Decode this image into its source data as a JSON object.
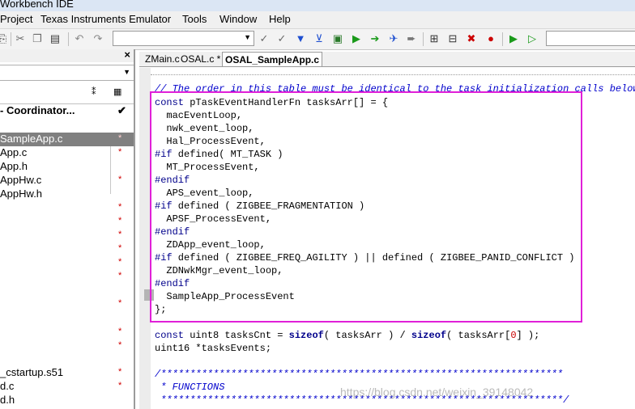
{
  "title": "Workbench IDE",
  "menu": [
    "Project",
    "Texas Instruments Emulator",
    "Tools",
    "Window",
    "Help"
  ],
  "workspace": {
    "config": "- Coordinator...",
    "config_check": "✔",
    "files": [
      {
        "name": "SampleApp.c",
        "mark": "*"
      },
      {
        "name": "App.c",
        "mark": "*"
      },
      {
        "name": "App.h",
        "mark": ""
      },
      {
        "name": "AppHw.c",
        "mark": "*"
      },
      {
        "name": "AppHw.h",
        "mark": ""
      },
      {
        "name": "",
        "mark": "*"
      },
      {
        "name": "",
        "mark": "*"
      },
      {
        "name": "",
        "mark": "*"
      },
      {
        "name": "",
        "mark": "*"
      },
      {
        "name": "",
        "mark": "*"
      },
      {
        "name": "",
        "mark": "*"
      },
      {
        "name": "",
        "mark": "*"
      },
      {
        "name": "",
        "mark": "*"
      },
      {
        "name": "_cstartup.s51",
        "mark": "*"
      },
      {
        "name": "d.c",
        "mark": "*"
      },
      {
        "name": "d.h",
        "mark": ""
      }
    ]
  },
  "tabs": [
    {
      "label": "ZMain.c"
    },
    {
      "label": "OSAL.c *"
    },
    {
      "label": "OSAL_SampleApp.c"
    }
  ],
  "code": {
    "comment_top": "// The order in this table must be identical to the task initialization calls below i",
    "l1_kw": "const",
    "l1_rest": " pTaskEventHandlerFn tasksArr[] = {",
    "l2": "  macEventLoop,",
    "l3": "  nwk_event_loop,",
    "l4": "  Hal_ProcessEvent,",
    "l5_kw": "#if",
    "l5_rest": " defined( MT_TASK )",
    "l6": "  MT_ProcessEvent,",
    "l7_kw": "#endif",
    "l8": "  APS_event_loop,",
    "l9_kw": "#if",
    "l9_rest": " defined ( ZIGBEE_FRAGMENTATION )",
    "l10": "  APSF_ProcessEvent,",
    "l11_kw": "#endif",
    "l12": "  ZDApp_event_loop,",
    "l13_kw": "#if",
    "l13_rest": " defined ( ZIGBEE_FREQ_AGILITY ) || defined ( ZIGBEE_PANID_CONFLICT )",
    "l14": "  ZDNwkMgr_event_loop,",
    "l15_kw": "#endif",
    "l16": "  SampleApp_ProcessEvent",
    "l17": "};",
    "l19_kw": "const",
    "l19_a": " uint8 tasksCnt = ",
    "l19_sz": "sizeof",
    "l19_b": "( tasksArr ) / ",
    "l19_sz2": "sizeof",
    "l19_c": "( tasksArr[",
    "l19_num": "0",
    "l19_d": "] );",
    "l20": "uint16 *tasksEvents;",
    "c1": "/*********************************************************************",
    "c2": " * FUNCTIONS",
    "c3": " *********************************************************************/"
  },
  "watermark": "https://blog.csdn.net/weixin_39148042"
}
